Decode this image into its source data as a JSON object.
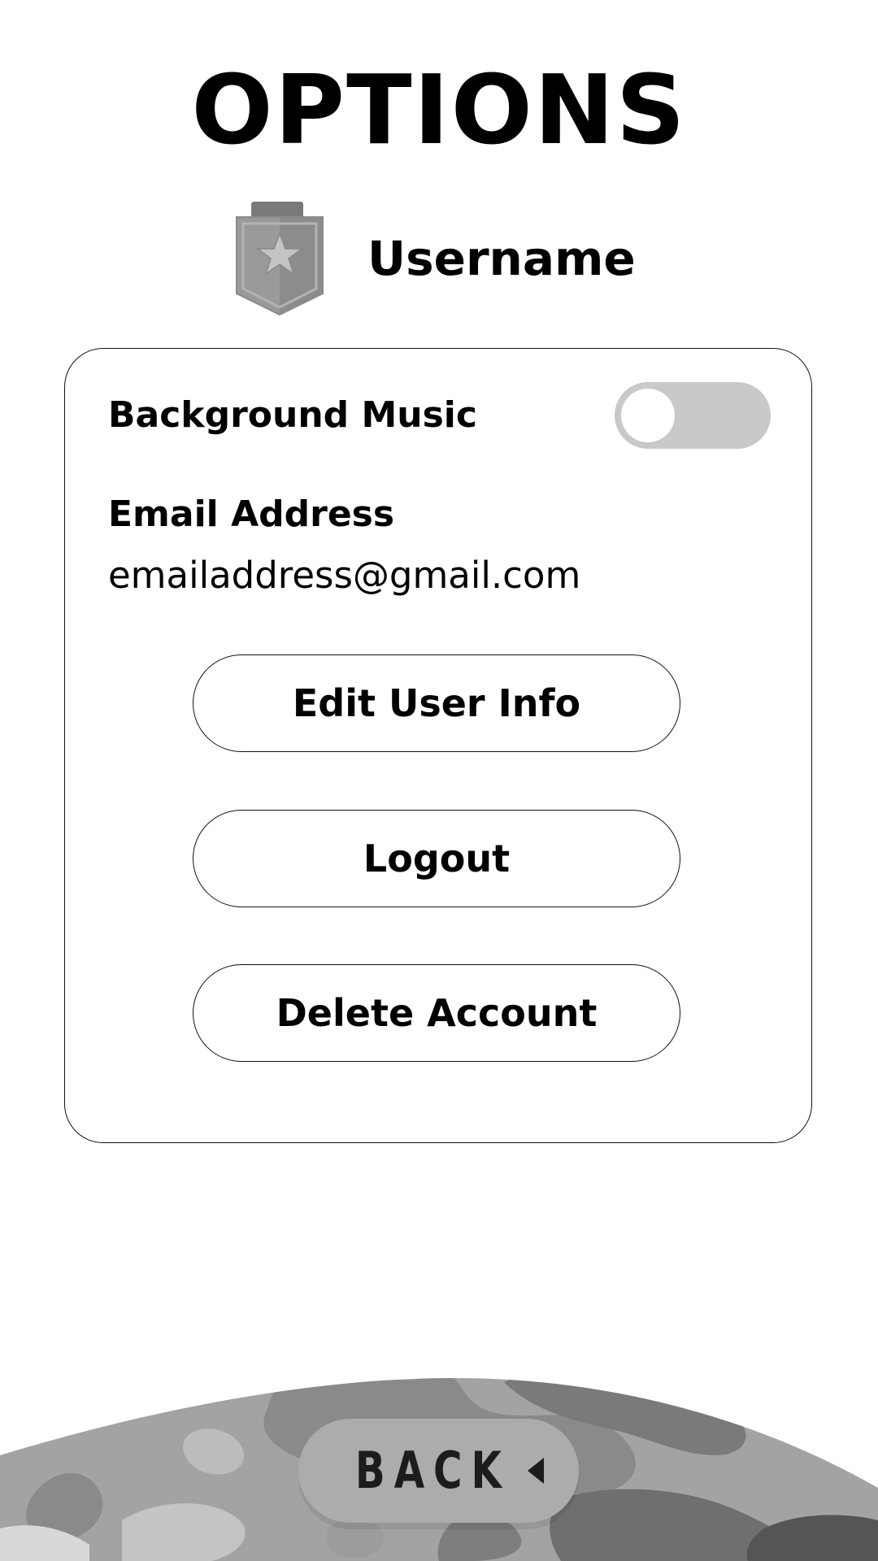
{
  "header": {
    "title": "OPTIONS"
  },
  "profile": {
    "username": "Username",
    "badge_icon": "shield-star-icon"
  },
  "settings": {
    "background_music": {
      "label": "Background Music",
      "enabled": false
    },
    "email": {
      "label": "Email Address",
      "value": "emailaddress@gmail.com"
    }
  },
  "actions": {
    "edit_label": "Edit User Info",
    "logout_label": "Logout",
    "delete_label": "Delete Account"
  },
  "footer": {
    "back_label": "BACK",
    "back_icon": "caret-left-icon"
  },
  "colors": {
    "toggle_track": "#c9c9c9",
    "back_button": "#acacac",
    "camo_dark": "#6f6f6f",
    "camo_mid": "#8f8f8f",
    "camo_light": "#b5b5b5"
  }
}
